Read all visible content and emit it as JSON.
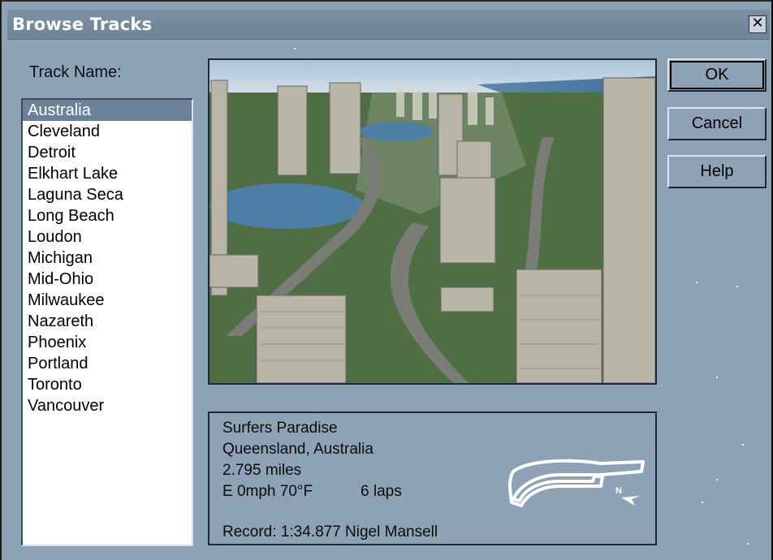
{
  "window": {
    "title": "Browse Tracks",
    "close_label": "✕"
  },
  "list": {
    "label": "Track Name:",
    "items": [
      "Australia",
      "Cleveland",
      "Detroit",
      "Elkhart Lake",
      "Laguna Seca",
      "Long Beach",
      "Loudon",
      "Michigan",
      "Mid-Ohio",
      "Milwaukee",
      "Nazareth",
      "Phoenix",
      "Portland",
      "Toronto",
      "Vancouver"
    ],
    "selected": "Australia"
  },
  "buttons": {
    "ok": "OK",
    "cancel": "Cancel",
    "help": "Help"
  },
  "info": {
    "name": "Surfers Paradise",
    "location": "Queensland, Australia",
    "length": "2.795 miles",
    "weather": "E 0mph  70°F",
    "laps": "6 laps",
    "record": "Record: 1:34.877 Nigel Mansell",
    "compass": "N"
  },
  "colors": {
    "dialog_bg": "#8ea2b6",
    "selection": "#6d8299",
    "title_bar": "#7489a0"
  }
}
